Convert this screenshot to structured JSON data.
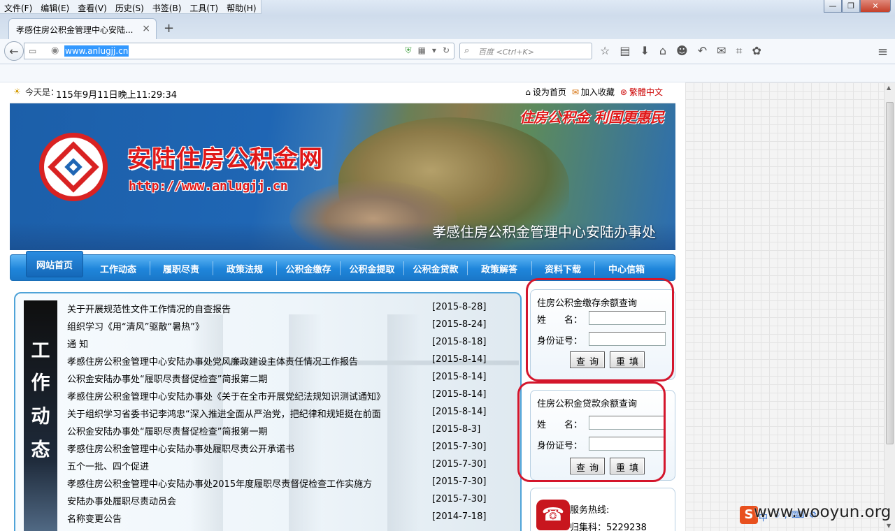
{
  "browser": {
    "menu": [
      "文件(F)",
      "编辑(E)",
      "查看(V)",
      "历史(S)",
      "书签(B)",
      "工具(T)",
      "帮助(H)"
    ],
    "tab_title": "孝感住房公积金管理中心安陆...",
    "url": "www.anlugjj.cn",
    "search_placeholder": "百度 <Ctrl+K>"
  },
  "topbar": {
    "today_label": "今天是：",
    "datetime": "115年9月11日晚上11:29:34",
    "set_home": "设为首页",
    "add_fav": "加入收藏",
    "traditional": "繁體中文"
  },
  "banner": {
    "title": "安陆住房公积金网",
    "url": "http://www.anlugjj.cn",
    "slogan": "住房公积金 利国更惠民",
    "office": "孝感住房公积金管理中心安陆办事处"
  },
  "nav": [
    "网站首页",
    "工作动态",
    "履职尽责",
    "政策法规",
    "公积金缴存",
    "公积金提取",
    "公积金贷款",
    "政策解答",
    "资料下载",
    "中心信箱"
  ],
  "news": {
    "sidebar_chars": [
      "工",
      "作",
      "动",
      "态"
    ],
    "items": [
      {
        "title": "关于开展规范性文件工作情况的自查报告",
        "date": "[2015-8-28]"
      },
      {
        "title": "组织学习《用“清风”驱散“暑热”》",
        "date": "[2015-8-24]"
      },
      {
        "title": "通 知",
        "date": "[2015-8-18]"
      },
      {
        "title": "孝感住房公积金管理中心安陆办事处党风廉政建设主体责任情况工作报告",
        "date": "[2015-8-14]"
      },
      {
        "title": "公积金安陆办事处“履职尽责督促检查”简报第二期",
        "date": "[2015-8-14]"
      },
      {
        "title": "孝感住房公积金管理中心安陆办事处《关于在全市开展党纪法规知识测试通知》",
        "date": "[2015-8-14]"
      },
      {
        "title": "关于组织学习省委书记李鸿忠“深入推进全面从严治党，把纪律和规矩挺在前面",
        "date": "[2015-8-14]"
      },
      {
        "title": "公积金安陆办事处“履职尽责督促检查”简报第一期",
        "date": "[2015-8-3]"
      },
      {
        "title": "孝感住房公积金管理中心安陆办事处履职尽责公开承诺书",
        "date": "[2015-7-30]"
      },
      {
        "title": "五个一批、四个促进",
        "date": "[2015-7-30]"
      },
      {
        "title": "孝感住房公积金管理中心安陆办事处2015年度履职尽责督促检查工作实施方",
        "date": "[2015-7-30]"
      },
      {
        "title": "安陆办事处履职尽责动员会",
        "date": "[2015-7-30]"
      },
      {
        "title": "名称变更公告",
        "date": "[2014-7-18]"
      }
    ]
  },
  "query_deposit": {
    "title": "住房公积金缴存余额查询",
    "name_label": "姓　　名：",
    "id_label": "身份证号：",
    "query_btn": "查询",
    "reset_btn": "重填"
  },
  "query_loan": {
    "title": "住房公积金贷款余额查询",
    "name_label": "姓　　名：",
    "id_label": "身份证号：",
    "query_btn": "查询",
    "reset_btn": "重填"
  },
  "hotline": {
    "label": "服务热线:",
    "line1": "归集科：5229238"
  },
  "watermark": "www.wooyun.org",
  "colors": {
    "accent_blue": "#1f86db",
    "red": "#d4162c",
    "title_red": "#e01818"
  }
}
